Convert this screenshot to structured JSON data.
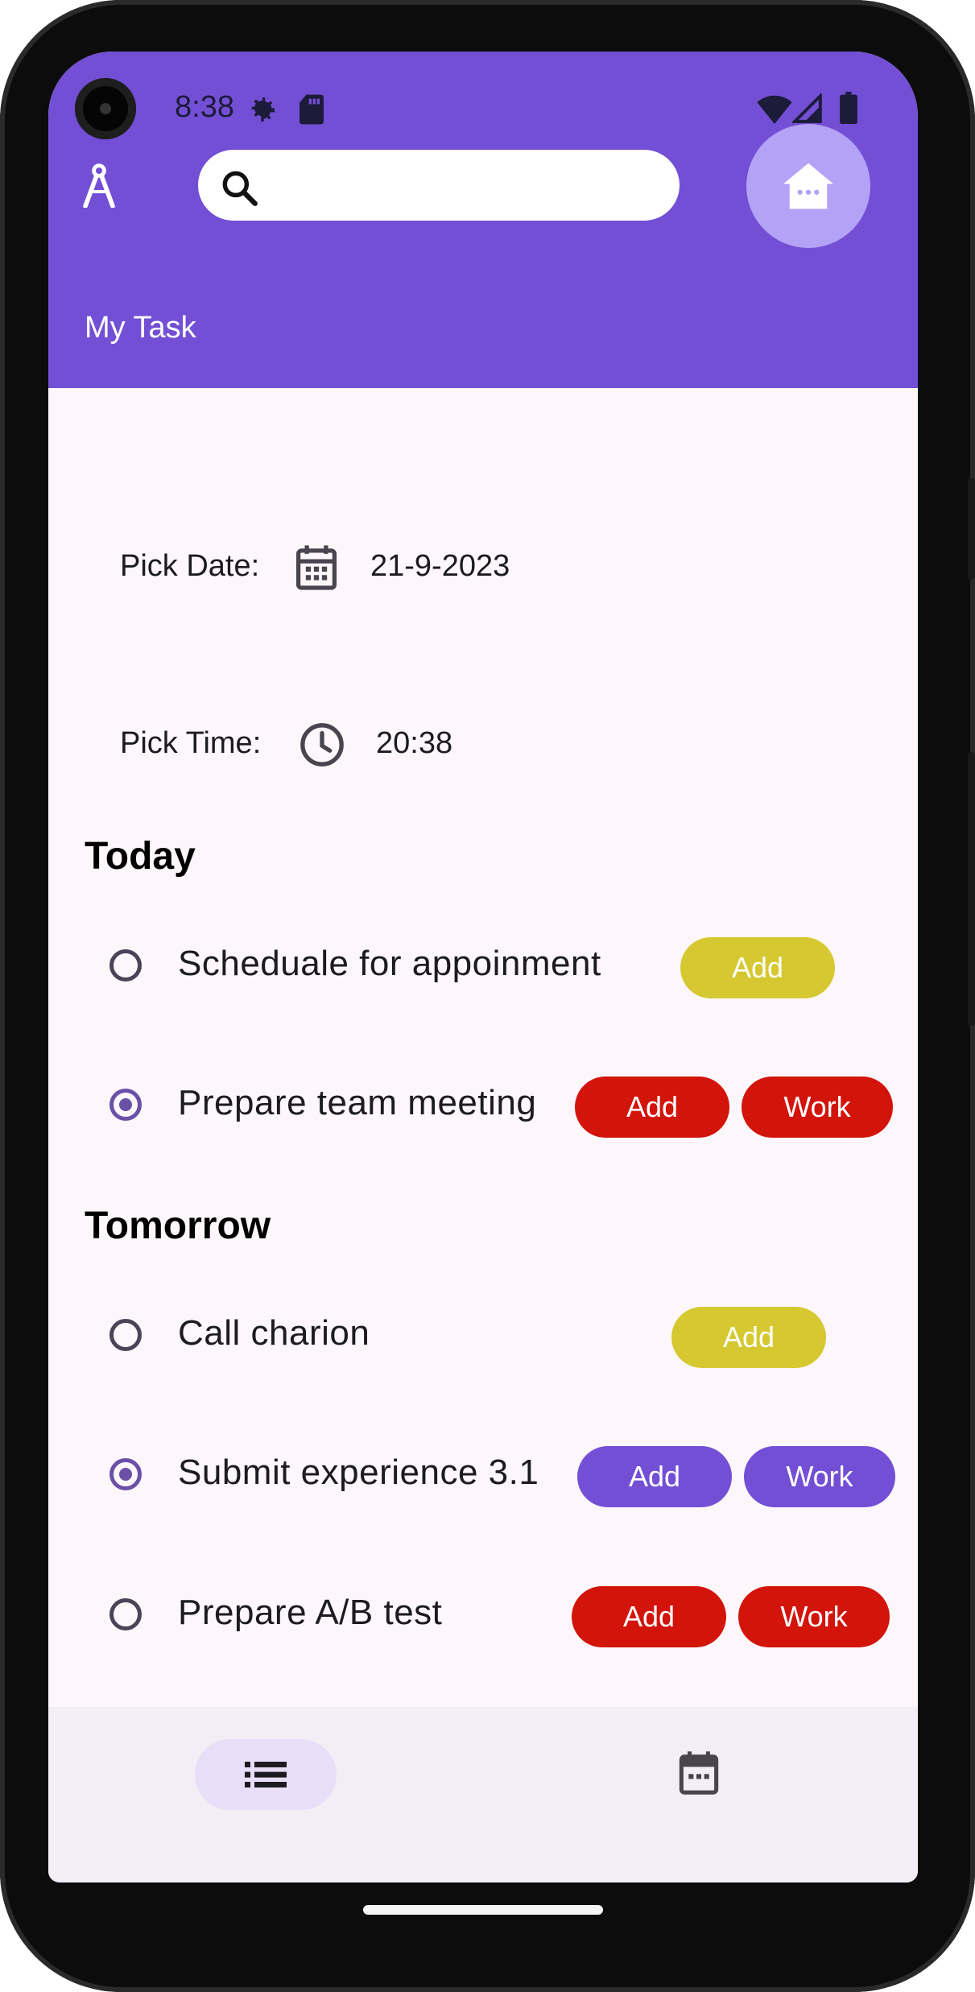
{
  "status": {
    "time": "8:38"
  },
  "header": {
    "search_placeholder": "",
    "title": "My Task"
  },
  "pickers": {
    "date_label": "Pick Date:",
    "date_value": "21-9-2023",
    "time_label": "Pick Time:",
    "time_value": "20:38"
  },
  "sections": [
    {
      "title": "Today",
      "tasks": [
        {
          "text": "Scheduale for appoinment",
          "checked": false,
          "chips": [
            {
              "label": "Add",
              "color": "#d6c830"
            }
          ]
        },
        {
          "text": "Prepare team meeting",
          "checked": true,
          "chips": [
            {
              "label": "Add",
              "color": "#d2140b"
            },
            {
              "label": "Work",
              "color": "#d2140b"
            }
          ]
        }
      ]
    },
    {
      "title": "Tomorrow",
      "tasks": [
        {
          "text": "Call charion",
          "checked": false,
          "chips": [
            {
              "label": "Add",
              "color": "#d6c830"
            }
          ]
        },
        {
          "text": "Submit experience 3.1",
          "checked": true,
          "chips": [
            {
              "label": "Add",
              "color": "#734fd5"
            },
            {
              "label": "Work",
              "color": "#734fd5"
            }
          ]
        },
        {
          "text": "Prepare A/B test",
          "checked": false,
          "chips": [
            {
              "label": "Add",
              "color": "#d2140b"
            },
            {
              "label": "Work",
              "color": "#d2140b"
            }
          ]
        }
      ]
    }
  ],
  "icons": {
    "logo": "compass-icon",
    "search": "search-icon",
    "fab": "home-icon",
    "date": "calendar-icon",
    "time": "clock-icon",
    "nav_list": "list-icon",
    "nav_calendar": "calendar-icon"
  },
  "colors": {
    "primary": "#734fd5",
    "fab": "#b3a2f6",
    "background": "#fdf7fb",
    "bottom_nav": "#f3eef5",
    "nav_indicator": "#e8def8"
  }
}
